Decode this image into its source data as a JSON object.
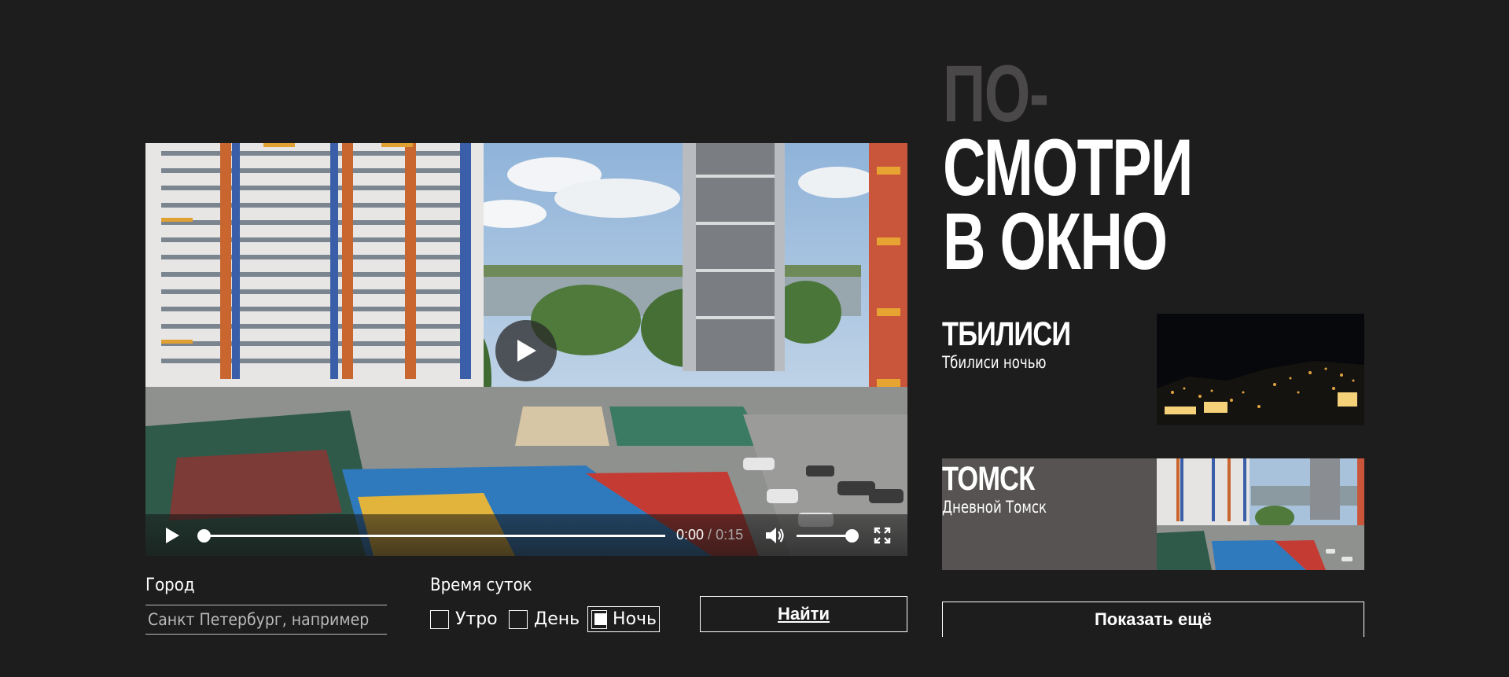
{
  "title": {
    "line1": "По-",
    "line2": "смотри",
    "line3": "в окно"
  },
  "player": {
    "current_time": "0:00",
    "separator": " / ",
    "duration": "0:15",
    "progress": 0.0,
    "volume": 1.0,
    "icons": [
      "play-icon",
      "volume-icon",
      "fullscreen-icon"
    ]
  },
  "search": {
    "city_label": "Город",
    "city_placeholder": "Санкт Петербург, например",
    "time_label": "Время суток",
    "options": [
      {
        "label": "Утро",
        "checked": false
      },
      {
        "label": "День",
        "checked": false
      },
      {
        "label": "Ночь",
        "checked": true
      }
    ],
    "submit_label": "Найти"
  },
  "cards": [
    {
      "name": "Тбилиси",
      "subtitle": "Тбилиси ночью",
      "active": false
    },
    {
      "name": "Томск",
      "subtitle": "Дневной Томск",
      "active": true
    }
  ],
  "more_label": "Показать ещё",
  "colors": {
    "background": "#1e1d1e",
    "title_muted": "#4a4848",
    "card_active": "#565352",
    "text": "#ffffff"
  }
}
